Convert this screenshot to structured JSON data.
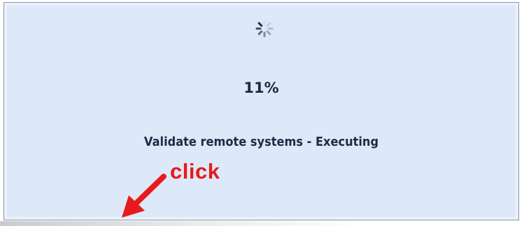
{
  "progress": {
    "percent_text": "11%",
    "percent_value": 11,
    "status_text": "Validate remote systems - Executing",
    "spinner_icon": "loading-spinner-icon"
  },
  "annotation": {
    "label": "click",
    "color": "#e81a1a",
    "arrow_icon": "red-arrow-icon"
  },
  "colors": {
    "panel_background": "#dde9f8",
    "text": "#1d2b44"
  }
}
